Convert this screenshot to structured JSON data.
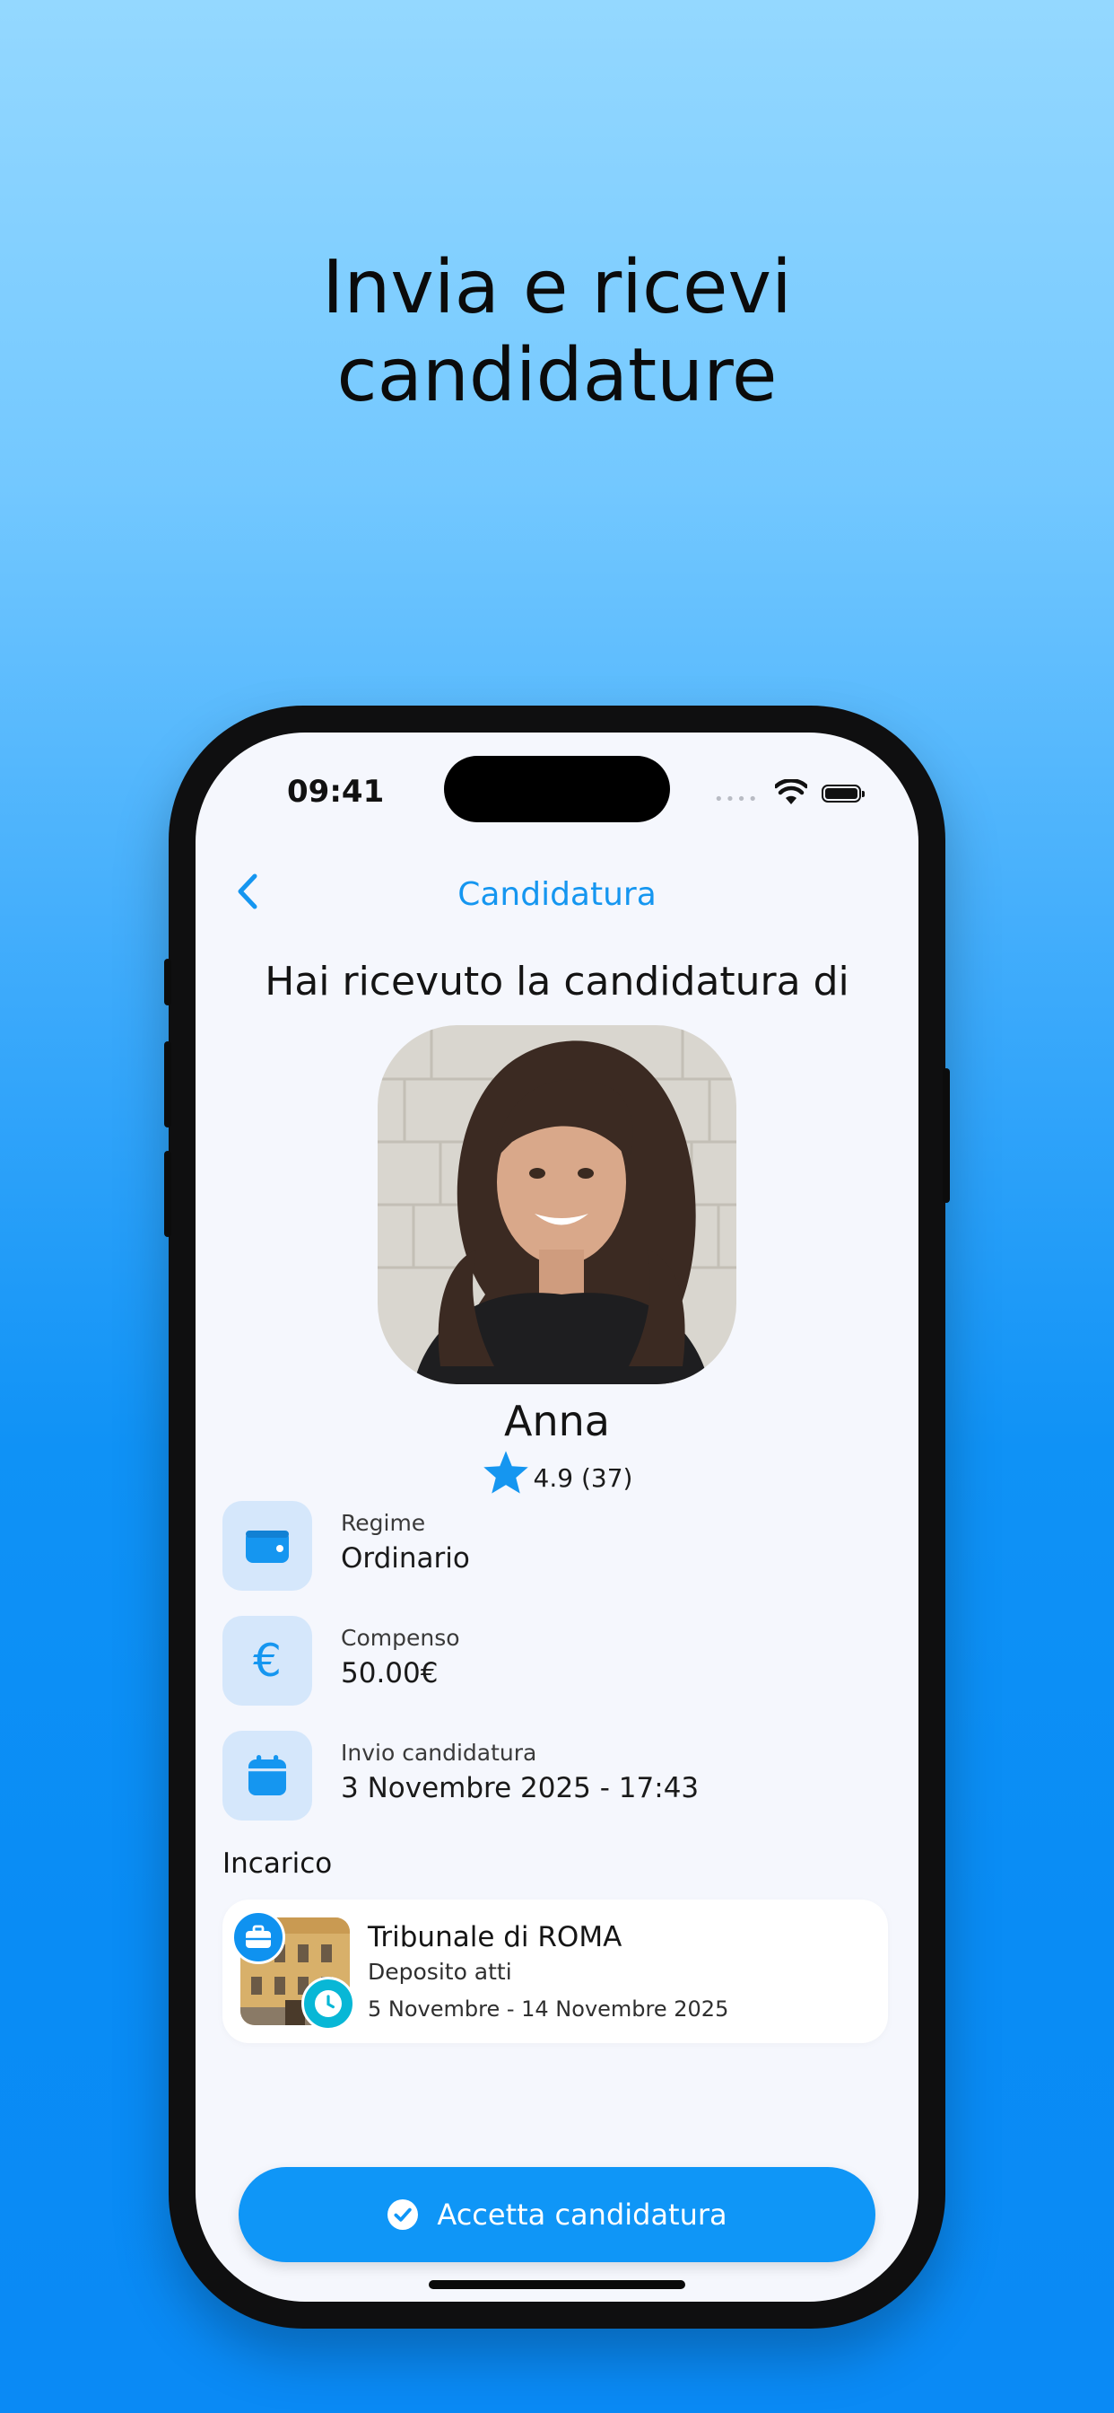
{
  "headline": {
    "line1": "Invia e ricevi",
    "line2": "candidature"
  },
  "status_bar": {
    "time": "09:41"
  },
  "nav": {
    "title": "Candidatura",
    "back_icon": "chevron-left-icon"
  },
  "intro_text": "Hai ricevuto la candidatura di",
  "candidate": {
    "name": "Anna",
    "rating": "4.9",
    "reviews": "(37)"
  },
  "details": [
    {
      "icon": "wallet-icon",
      "label": "Regime",
      "value": "Ordinario"
    },
    {
      "icon": "euro-icon",
      "label": "Compenso",
      "value": "50.00€"
    },
    {
      "icon": "calendar-icon",
      "label": "Invio candidatura",
      "value": "3 Novembre 2025 - 17:43"
    }
  ],
  "assignment": {
    "section_title": "Incarico",
    "title": "Tribunale di ROMA",
    "type": "Deposito atti",
    "dates": "5 Novembre - 14 Novembre 2025"
  },
  "accept_button": {
    "label": "Accetta candidatura"
  },
  "colors": {
    "accent": "#1596f0",
    "icon_bg": "#d5e7fb",
    "screen_bg": "#f5f7fd",
    "clock_badge": "#08b7d6"
  }
}
